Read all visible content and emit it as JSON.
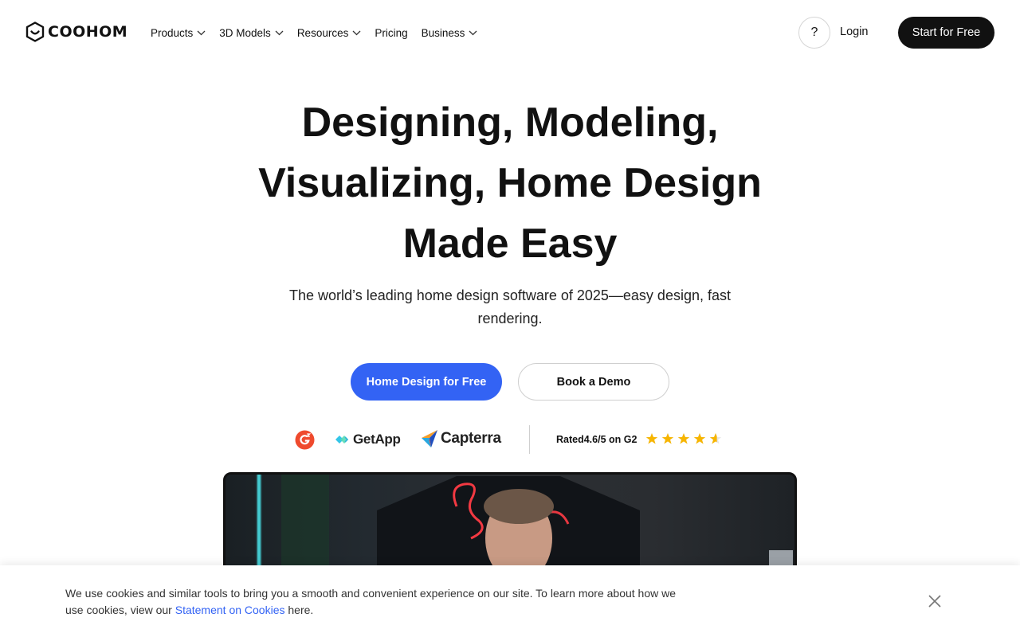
{
  "header": {
    "logo_text": "COOHOM",
    "nav": [
      {
        "label": "Products",
        "has_dropdown": true
      },
      {
        "label": "3D Models",
        "has_dropdown": true
      },
      {
        "label": "Resources",
        "has_dropdown": true
      },
      {
        "label": "Pricing",
        "has_dropdown": false
      },
      {
        "label": "Business",
        "has_dropdown": true
      }
    ],
    "help_label": "?",
    "login_label": "Login",
    "start_label": "Start for Free"
  },
  "hero": {
    "title_line1": "Designing, Modeling,",
    "title_line2": "Visualizing, Home Design",
    "title_line3": "Made Easy",
    "subtitle": "The world’s leading home design software of 2025—easy design, fast rendering.",
    "cta_primary": "Home Design for Free",
    "cta_secondary": "Book a Demo"
  },
  "ratings": {
    "getapp_label": "GetApp",
    "capterra_label": "Capterra",
    "rated_text": "Rated4.6/5 on G2",
    "rating": 4.6,
    "star_count": 5,
    "star_color": "#f7b500"
  },
  "cookie": {
    "text_before": "We use cookies and similar tools to bring you a smooth and convenient experience on our site. To learn more about how we use cookies, view our ",
    "link_text": "Statement on Cookies",
    "text_after": " here."
  },
  "colors": {
    "accent": "#3363f4",
    "dark": "#111111"
  }
}
